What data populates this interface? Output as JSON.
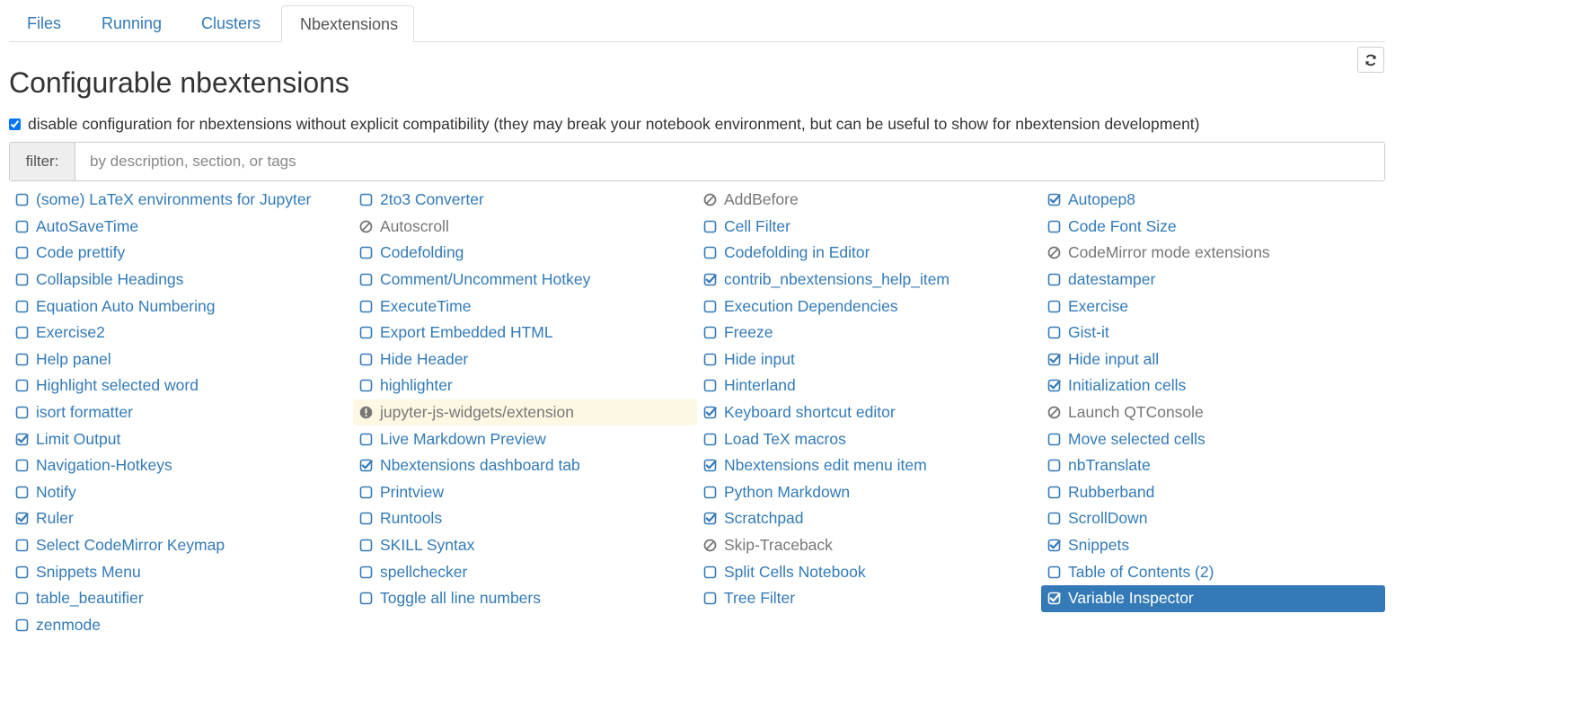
{
  "tabs": [
    "Files",
    "Running",
    "Clusters",
    "Nbextensions"
  ],
  "page_title": "Configurable nbextensions",
  "compat_text": "disable configuration for nbextensions without explicit compatibility (they may break your notebook environment, but can be useful to show for nbextension development)",
  "compat_checked": true,
  "filter": {
    "label": "filter:",
    "placeholder": "by description, section, or tags",
    "value": ""
  },
  "colors": {
    "link": "#337ab7",
    "muted": "#777777",
    "warning_bg": "#fcf8e3",
    "selected_bg": "#337ab7"
  },
  "extensions": [
    {
      "label": "(some) LaTeX environments for Jupyter",
      "state": "unchecked"
    },
    {
      "label": "2to3 Converter",
      "state": "unchecked"
    },
    {
      "label": "AddBefore",
      "state": "disabled"
    },
    {
      "label": "Autopep8",
      "state": "checked"
    },
    {
      "label": "AutoSaveTime",
      "state": "unchecked"
    },
    {
      "label": "Autoscroll",
      "state": "disabled"
    },
    {
      "label": "Cell Filter",
      "state": "unchecked"
    },
    {
      "label": "Code Font Size",
      "state": "unchecked"
    },
    {
      "label": "Code prettify",
      "state": "unchecked"
    },
    {
      "label": "Codefolding",
      "state": "unchecked"
    },
    {
      "label": "Codefolding in Editor",
      "state": "unchecked"
    },
    {
      "label": "CodeMirror mode extensions",
      "state": "disabled"
    },
    {
      "label": "Collapsible Headings",
      "state": "unchecked"
    },
    {
      "label": "Comment/Uncomment Hotkey",
      "state": "unchecked"
    },
    {
      "label": "contrib_nbextensions_help_item",
      "state": "checked"
    },
    {
      "label": "datestamper",
      "state": "unchecked"
    },
    {
      "label": "Equation Auto Numbering",
      "state": "unchecked"
    },
    {
      "label": "ExecuteTime",
      "state": "unchecked"
    },
    {
      "label": "Execution Dependencies",
      "state": "unchecked"
    },
    {
      "label": "Exercise",
      "state": "unchecked"
    },
    {
      "label": "Exercise2",
      "state": "unchecked"
    },
    {
      "label": "Export Embedded HTML",
      "state": "unchecked"
    },
    {
      "label": "Freeze",
      "state": "unchecked"
    },
    {
      "label": "Gist-it",
      "state": "unchecked"
    },
    {
      "label": "Help panel",
      "state": "unchecked"
    },
    {
      "label": "Hide Header",
      "state": "unchecked"
    },
    {
      "label": "Hide input",
      "state": "unchecked"
    },
    {
      "label": "Hide input all",
      "state": "checked"
    },
    {
      "label": "Highlight selected word",
      "state": "unchecked"
    },
    {
      "label": "highlighter",
      "state": "unchecked"
    },
    {
      "label": "Hinterland",
      "state": "unchecked"
    },
    {
      "label": "Initialization cells",
      "state": "checked"
    },
    {
      "label": "isort formatter",
      "state": "unchecked"
    },
    {
      "label": "jupyter-js-widgets/extension",
      "state": "warning"
    },
    {
      "label": "Keyboard shortcut editor",
      "state": "checked"
    },
    {
      "label": "Launch QTConsole",
      "state": "disabled"
    },
    {
      "label": "Limit Output",
      "state": "checked"
    },
    {
      "label": "Live Markdown Preview",
      "state": "unchecked"
    },
    {
      "label": "Load TeX macros",
      "state": "unchecked"
    },
    {
      "label": "Move selected cells",
      "state": "unchecked"
    },
    {
      "label": "Navigation-Hotkeys",
      "state": "unchecked"
    },
    {
      "label": "Nbextensions dashboard tab",
      "state": "checked"
    },
    {
      "label": "Nbextensions edit menu item",
      "state": "checked"
    },
    {
      "label": "nbTranslate",
      "state": "unchecked"
    },
    {
      "label": "Notify",
      "state": "unchecked"
    },
    {
      "label": "Printview",
      "state": "unchecked"
    },
    {
      "label": "Python Markdown",
      "state": "unchecked"
    },
    {
      "label": "Rubberband",
      "state": "unchecked"
    },
    {
      "label": "Ruler",
      "state": "checked"
    },
    {
      "label": "Runtools",
      "state": "unchecked"
    },
    {
      "label": "Scratchpad",
      "state": "checked"
    },
    {
      "label": "ScrollDown",
      "state": "unchecked"
    },
    {
      "label": "Select CodeMirror Keymap",
      "state": "unchecked"
    },
    {
      "label": "SKILL Syntax",
      "state": "unchecked"
    },
    {
      "label": "Skip-Traceback",
      "state": "disabled"
    },
    {
      "label": "Snippets",
      "state": "checked"
    },
    {
      "label": "Snippets Menu",
      "state": "unchecked"
    },
    {
      "label": "spellchecker",
      "state": "unchecked"
    },
    {
      "label": "Split Cells Notebook",
      "state": "unchecked"
    },
    {
      "label": "Table of Contents (2)",
      "state": "unchecked"
    },
    {
      "label": "table_beautifier",
      "state": "unchecked"
    },
    {
      "label": "Toggle all line numbers",
      "state": "unchecked"
    },
    {
      "label": "Tree Filter",
      "state": "unchecked"
    },
    {
      "label": "Variable Inspector",
      "state": "checked",
      "selected": true
    },
    {
      "label": "zenmode",
      "state": "unchecked"
    }
  ]
}
